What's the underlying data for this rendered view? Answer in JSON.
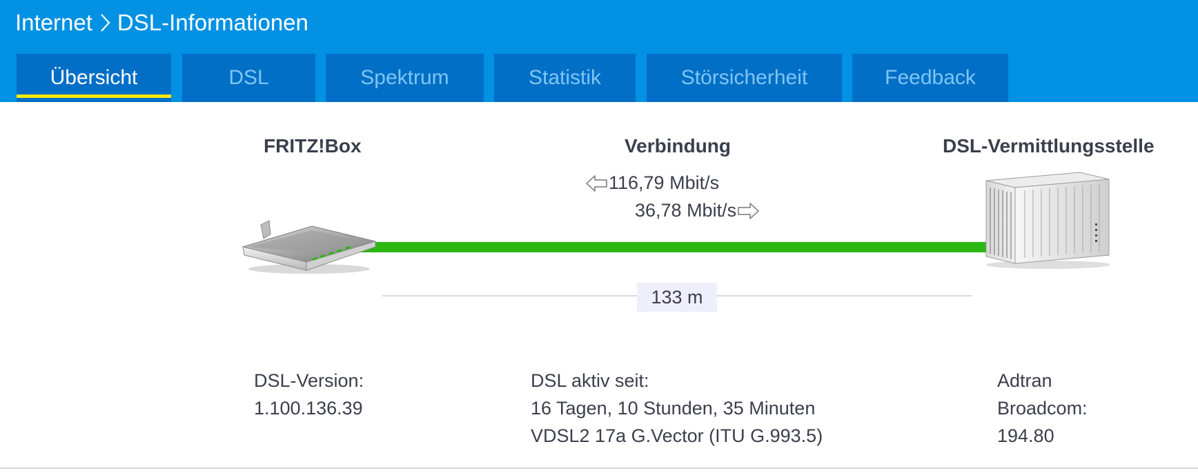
{
  "breadcrumb": {
    "parent": "Internet",
    "current": "DSL-Informationen"
  },
  "tabs": [
    {
      "label": "Übersicht",
      "active": true
    },
    {
      "label": "DSL",
      "active": false
    },
    {
      "label": "Spektrum",
      "active": false
    },
    {
      "label": "Statistik",
      "active": false
    },
    {
      "label": "Störsicherheit",
      "active": false
    },
    {
      "label": "Feedback",
      "active": false
    }
  ],
  "diagram": {
    "device_title": "FRITZ!Box",
    "connection_title": "Verbindung",
    "exchange_title": "DSL-Vermittlungsstelle",
    "downstream": "116,79 Mbit/s",
    "upstream": "36,78 Mbit/s",
    "distance": "133 m",
    "line_status_color": "#2db713"
  },
  "info": {
    "device": {
      "label": "DSL-Version:",
      "value": "1.100.136.39"
    },
    "connection": {
      "label": "DSL aktiv seit:",
      "duration": "16 Tagen, 10 Stunden, 35 Minuten",
      "standard": "VDSL2 17a G.Vector (ITU G.993.5)"
    },
    "exchange": {
      "vendor": "Adtran",
      "chipset_label": "Broadcom:",
      "chipset_version": "194.80"
    }
  },
  "icons": {
    "breadcrumb_separator": "chevron-right-icon",
    "downstream": "arrow-left-outline-icon",
    "upstream": "arrow-right-outline-icon",
    "device": "router-icon",
    "exchange": "dslam-icon"
  },
  "colors": {
    "header_bg": "#0291e3",
    "tab_bg": "#026fc6",
    "tab_inactive_text": "#7ec6f5",
    "active_tab_indicator": "#f3ea0a"
  }
}
